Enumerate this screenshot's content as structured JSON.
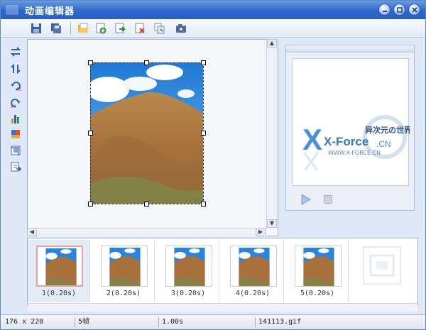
{
  "window": {
    "title": "动画编辑器"
  },
  "toolbar": {
    "buttons": [
      "save-icon",
      "save-all-icon",
      "open-folder-icon",
      "add-frame-icon",
      "insert-frame-icon",
      "delete-frame-icon",
      "copy-frame-icon",
      "camera-icon"
    ]
  },
  "left_tools": [
    "flip-horizontal-icon",
    "flip-vertical-icon",
    "rotate-left-90-icon",
    "rotate-right-90-icon",
    "histogram-icon",
    "color-balance-icon",
    "crop-icon",
    "export-icon"
  ],
  "preview": {
    "watermark_main": "X-Force",
    "watermark_sub": ".CN",
    "watermark_cn": "异次元の世界",
    "watermark_url": "WWW.X-FORCE.CN"
  },
  "frames": [
    {
      "label": "1(0.20s)",
      "selected": true
    },
    {
      "label": "2(0.20s)",
      "selected": false
    },
    {
      "label": "3(0.20s)",
      "selected": false
    },
    {
      "label": "4(0.20s)",
      "selected": false
    },
    {
      "label": "5(0.20s)",
      "selected": false
    }
  ],
  "status": {
    "size": "176 x 220",
    "frames": "5帧",
    "duration": "1.00s",
    "filename": "141113.gif"
  },
  "colors": {
    "titlebar": "#2f66c9",
    "accent": "#5b88c9"
  }
}
